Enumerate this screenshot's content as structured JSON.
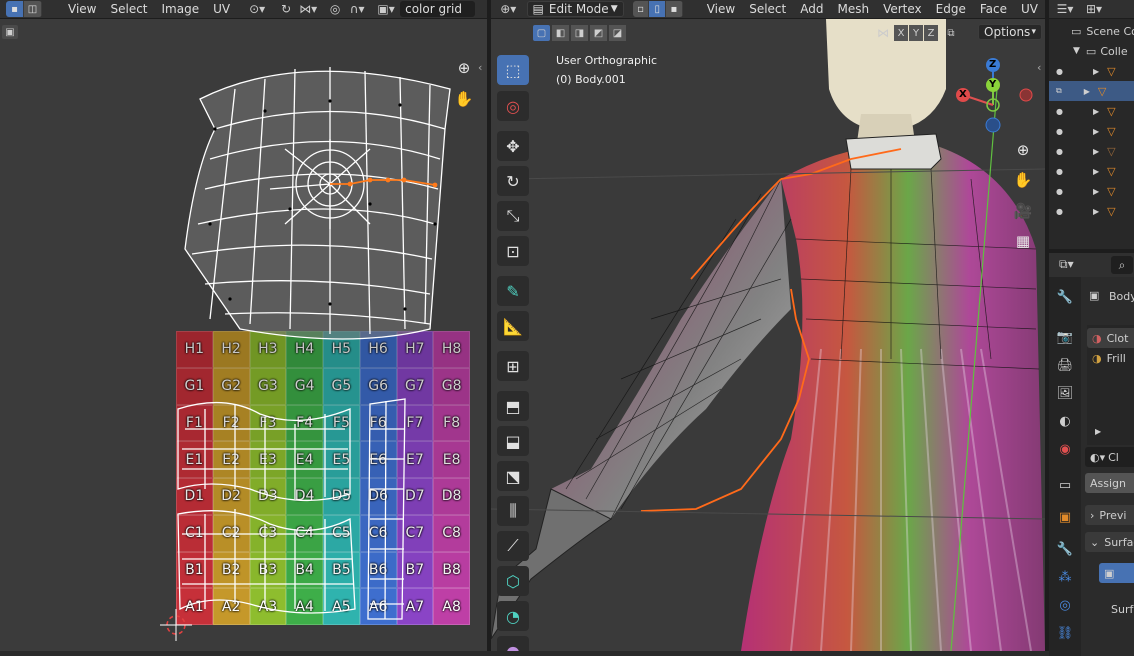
{
  "uv_header": {
    "menus": [
      "View",
      "Select",
      "Image",
      "UV"
    ],
    "image_name": "color grid"
  },
  "viewport_header": {
    "mode": "Edit Mode",
    "menus": [
      "View",
      "Select",
      "Add",
      "Mesh",
      "Vertex",
      "Edge",
      "Face",
      "UV"
    ],
    "axes": [
      "X",
      "Y",
      "Z"
    ],
    "options_label": "Options"
  },
  "viewport": {
    "view_name": "User Orthographic",
    "object_name": "(0) Body.001"
  },
  "gizmo": {
    "x": "X",
    "y": "Y",
    "z": "Z"
  },
  "color_grid": {
    "rows": [
      [
        "H1",
        "H2",
        "H3",
        "H4",
        "H5",
        "H6",
        "H7",
        "H8"
      ],
      [
        "G1",
        "G2",
        "G3",
        "G4",
        "G5",
        "G6",
        "G7",
        "G8"
      ],
      [
        "F1",
        "F2",
        "F3",
        "F4",
        "F5",
        "F6",
        "F7",
        "F8"
      ],
      [
        "E1",
        "E2",
        "E3",
        "E4",
        "E5",
        "E6",
        "E7",
        "E8"
      ],
      [
        "D1",
        "D2",
        "D3",
        "D4",
        "D5",
        "D6",
        "D7",
        "D8"
      ],
      [
        "C1",
        "C2",
        "C3",
        "C4",
        "C5",
        "C6",
        "C7",
        "C8"
      ],
      [
        "B1",
        "B2",
        "B3",
        "B4",
        "B5",
        "B6",
        "B7",
        "B8"
      ],
      [
        "A1",
        "A2",
        "A3",
        "A4",
        "A5",
        "A6",
        "A7",
        "A8"
      ]
    ],
    "column_colors": [
      "#c8303a",
      "#c79a2a",
      "#8fbf2e",
      "#3fb04a",
      "#2fb5b0",
      "#3f6fd0",
      "#8b45c8",
      "#c040a8"
    ]
  },
  "outliner": {
    "scene_label": "Scene Co",
    "collection_label": "Colle"
  },
  "properties": {
    "object_label": "Body",
    "material_slots": [
      "Clot",
      "Frill"
    ],
    "material_field": "Cl",
    "assign_label": "Assign",
    "panels": [
      "Previ",
      "Surfac"
    ],
    "surface_label": "Surfa"
  },
  "colors": {
    "accent": "#4772b3",
    "selected_edge": "#ff7a1a",
    "header_bg": "#303030"
  }
}
